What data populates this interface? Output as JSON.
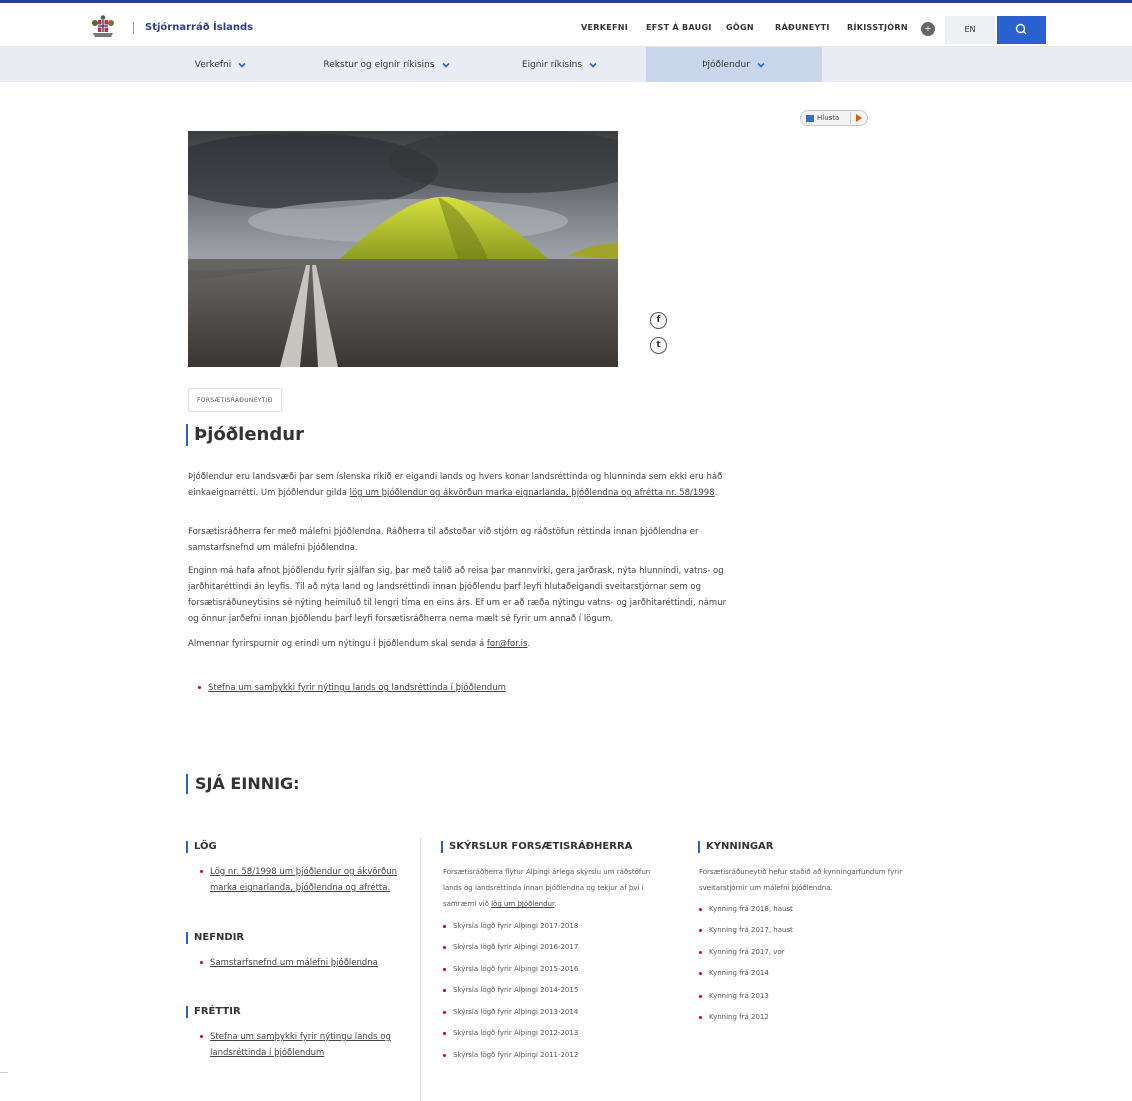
{
  "header": {
    "site_name": "Stjórnarráð Íslands",
    "nav": [
      "VERKEFNI",
      "EFST Á BAUGI",
      "GÖGN",
      "RÁÐUNEYTI",
      "RÍKISSTJÓRN"
    ],
    "lang": "EN"
  },
  "subnav": {
    "items": [
      "Verkefni",
      "Rekstur og eignir ríkisins",
      "Eignir ríkisins",
      "Þjóðlendur"
    ]
  },
  "listen": {
    "label": "Hlusta"
  },
  "page": {
    "tag": "FORSÆTISRÁÐUNEYTIÐ",
    "title": "Þjóðlendur",
    "p1_pre": "Þjóðlendur eru landsvæði þar sem íslenska ríkið er eigandi lands og hvers konar landsréttinda og hlunninda sem ekki eru háð einkaeignarrétti. Um þjóðlendur gilda ",
    "p1_link": "lög um þjóðlendur og ákvörðun marka eignarlanda, þjóðlendna og afrétta nr. 58/1998",
    "p1_post": ".",
    "p2": "Forsætisráðherra fer með málefni þjóðlendna. Ráðherra til aðstoðar við stjórn og ráðstöfun réttinda innan þjóðlendna er samstarfsnefnd um málefni þjóðlendna.",
    "p3": "Enginn má hafa afnot þjóðlendu fyrir sjálfan sig, þar með talið að reisa þar mannvirki, gera jarðrask, nýta hlunnindi, vatns- og jarðhitaréttindi án leyfis. Til að nýta land og landsréttindi innan þjóðlendu þarf leyfi hlutaðeigandi sveitarstjórnar sem og forsætisráðuneytisins sé nýting heimiluð til lengri tíma en eins árs. Ef um er að ræða nýtingu vatns- og jarðhitaréttindi, námur og önnur jarðefni innan þjóðlendu þarf leyfi forsætisráðherra nema mælt sé fyrir um annað í lögum.",
    "p4_pre": "Almennar fyrirspurnir og erindi um nýtingu í þjóðlendum skal senda á ",
    "p4_link": "for@for.is",
    "p4_post": ".",
    "bullet": "Stefna um samþykki fyrir nýtingu lands og landsréttinda í þjóðlendum"
  },
  "see_also": {
    "title": "SJÁ EINNIG:",
    "log": {
      "heading": "LÖG",
      "link": "Lög nr. 58/1998 um þjóðlendur og ákvörðun marka eignarlanda, þjóðlendna og afrétta."
    },
    "nefndir": {
      "heading": "NEFNDIR",
      "link": "Samstarfsnefnd um málefni þjóðlendna"
    },
    "frettir": {
      "heading": "FRÉTTIR",
      "link": "Stefna um samþykki fyrir nýtingu lands og landsréttinda í þjóðlendum"
    },
    "skyrslur": {
      "heading": "SKÝRSLUR FORSÆTISRÁÐHERRA",
      "text_pre": "Forsætisráðherra flytur Alþingi árlega skýrslu um ráðstöfun lands og landsréttinda innan þjóðlendna og tekjur af því í samræmi við ",
      "text_link": "lög um þjóðlendur",
      "text_post": ".",
      "items": [
        "Skýrsla lögð fyrir Alþingi 2017-2018",
        "Skýrsla lögð fyrir Alþingi 2016-2017",
        "Skýrsla lögð fyrir Alþingi 2015-2016",
        "Skýrsla lögð fyrir Alþingi 2014-2015",
        "Skýrsla lögð fyrir Alþingi 2013-2014",
        "Skýrsla lögð fyrir Alþingi 2012-2013",
        "Skýrsla lögð fyrir Alþingi 2011-2012"
      ]
    },
    "kynningar": {
      "heading": "KYNNINGAR",
      "text": "Forsætisráðuneytið hefur staðið að kynningarfundum fyrir sveitarstjórnir um málefni þjóðlendna.",
      "items": [
        "Kynning frá 2018, haust",
        "Kynning frá 2017, haust",
        "Kynning frá 2017, vor",
        "Kynning frá 2014",
        "Kynning frá 2013",
        "Kynning frá 2012"
      ]
    }
  },
  "colors": {
    "brand": "#2a3f8f",
    "accent": "#2b60d0",
    "bullet": "#d0021b"
  }
}
